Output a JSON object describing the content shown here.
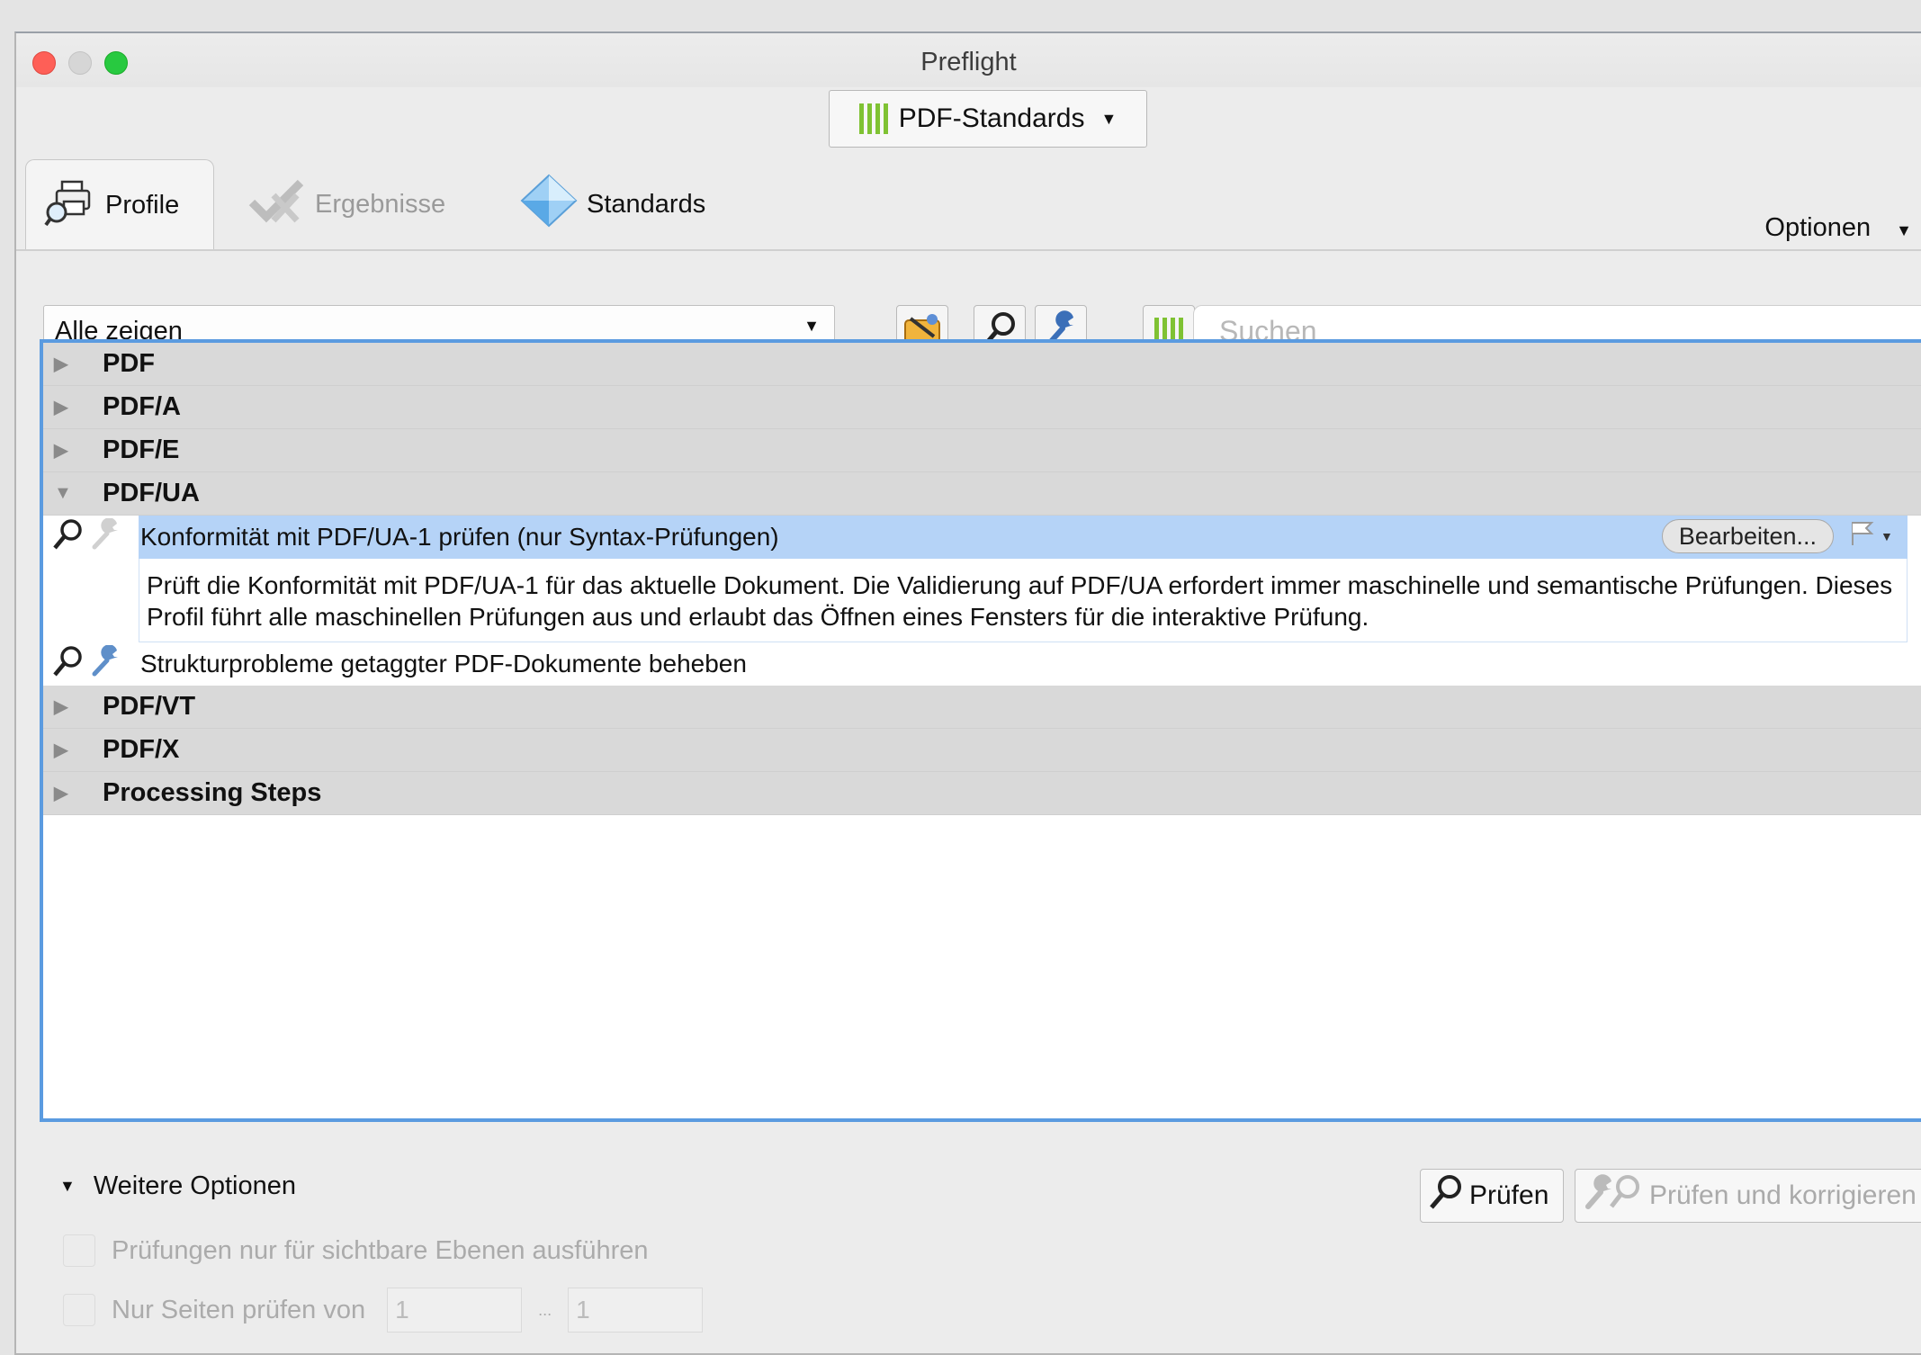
{
  "window": {
    "title": "Preflight"
  },
  "standards_dropdown": {
    "label": "PDF-Standards",
    "icon": "bars-icon",
    "accent": "#7fc233"
  },
  "tabs": [
    {
      "label": "Profile",
      "icon": "printer-magnifier-icon",
      "active": true
    },
    {
      "label": "Ergebnisse",
      "icon": "checkmark-cross-icon",
      "active": false
    },
    {
      "label": "Standards",
      "icon": "diamond-icon",
      "active": false
    }
  ],
  "options_menu": {
    "label": "Optionen"
  },
  "filter": {
    "value": "Alle zeigen"
  },
  "search": {
    "placeholder": "Suchen"
  },
  "groups": {
    "pdf": "PDF",
    "pdfa": "PDF/A",
    "pdfe": "PDF/E",
    "pdfua": "PDF/UA",
    "pdfvt": "PDF/VT",
    "pdfx": "PDF/X",
    "processing": "Processing Steps"
  },
  "profiles": {
    "selected": {
      "label": "Konformität mit PDF/UA-1 prüfen (nur Syntax-Prüfungen)",
      "edit_label": "Bearbeiten...",
      "description": "Prüft die Konformität mit PDF/UA-1 für das aktuelle Dokument. Die Validierung auf PDF/UA erfordert immer maschinelle und semantische Prüfungen. Dieses Profil führt alle maschinellen Prüfungen aus und erlaubt das Öffnen eines Fensters für die interaktive Prüfung."
    },
    "second": {
      "label": "Strukturprobleme getaggter PDF-Dokumente beheben"
    }
  },
  "bottom": {
    "more_options": "Weitere Optionen",
    "check_button": "Prüfen",
    "fix_button": "Prüfen und korrigieren",
    "visible_layers": "Prüfungen nur für sichtbare Ebenen ausführen",
    "pages_label": "Nur Seiten prüfen von",
    "page_from": "1",
    "page_sep": "...",
    "page_to": "1"
  },
  "colors": {
    "selection": "#b5d3f7",
    "focus_ring": "#5b9be0"
  }
}
